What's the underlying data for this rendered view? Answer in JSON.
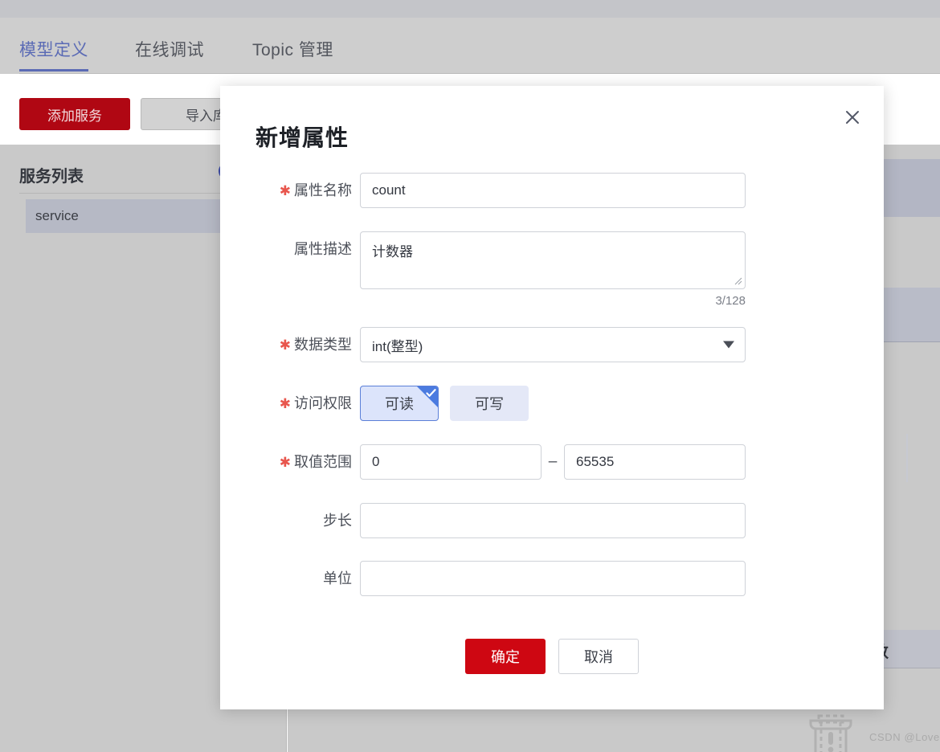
{
  "background": {
    "tabs": [
      {
        "label": "模型定义",
        "active": true
      },
      {
        "label": "在线调试",
        "active": false
      },
      {
        "label": "Topic 管理",
        "active": false
      }
    ],
    "toolbar": {
      "add_service_label": "添加服务",
      "import_library_label": "导入库模"
    },
    "sidebar": {
      "title": "服务列表",
      "add_icon": "plus-circle-icon",
      "items": [
        {
          "label": "service",
          "selected": true
        }
      ]
    },
    "main": {
      "partial_label": "数"
    },
    "watermark": {
      "text": "CSDN @Lovex.",
      "illustration": "dashed-trash-warning-icon"
    },
    "colors": {
      "accent_blue": "#5b6bb5",
      "primary_red": "#b00713",
      "page_bg": "#c9c9c9"
    }
  },
  "modal": {
    "title": "新增属性",
    "close_icon": "close-icon",
    "fields": {
      "name": {
        "label": "属性名称",
        "required": true,
        "value": "count",
        "placeholder": ""
      },
      "description": {
        "label": "属性描述",
        "required": false,
        "value": "计数器",
        "placeholder": "",
        "counter": "3/128"
      },
      "data_type": {
        "label": "数据类型",
        "required": true,
        "value": "int(整型)",
        "caret_icon": "chevron-down-icon",
        "options": [
          "int(整型)"
        ]
      },
      "access": {
        "label": "访问权限",
        "required": true,
        "options": [
          {
            "label": "可读",
            "selected": true
          },
          {
            "label": "可写",
            "selected": false
          }
        ],
        "check_icon": "check-icon"
      },
      "range": {
        "label": "取值范围",
        "required": true,
        "min_value": "0",
        "max_value": "65535",
        "separator": "–",
        "min_placeholder": "",
        "max_placeholder": ""
      },
      "step": {
        "label": "步长",
        "required": false,
        "value": "",
        "placeholder": ""
      },
      "unit": {
        "label": "单位",
        "required": false,
        "value": "",
        "placeholder": ""
      }
    },
    "actions": {
      "confirm_label": "确定",
      "cancel_label": "取消"
    },
    "colors": {
      "confirm_red": "#ce0712",
      "selected_blue": "#4b7be0",
      "required_star": "#e8564d"
    }
  }
}
